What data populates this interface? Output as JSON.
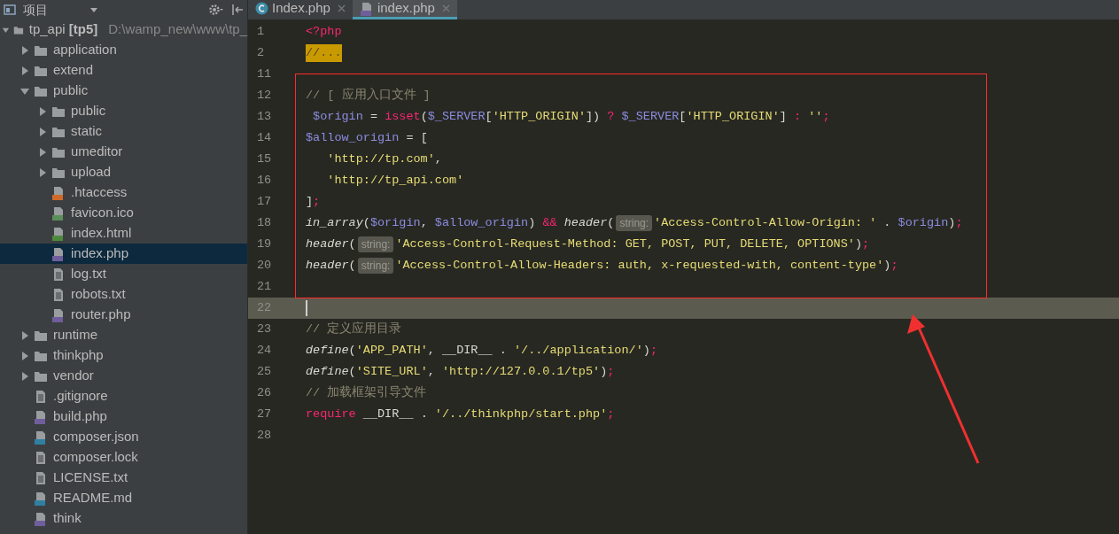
{
  "sidebar": {
    "title": "项目",
    "tree": [
      {
        "label": "tp_api **[tp5]**",
        "path": "D:\\wamp_new\\www\\tp_",
        "kind": "folder",
        "expanded": true,
        "selected": false,
        "children": [
          {
            "label": "application",
            "kind": "folder",
            "expanded": false,
            "selected": false
          },
          {
            "label": "extend",
            "kind": "folder",
            "expanded": false,
            "selected": false
          },
          {
            "label": "public",
            "kind": "folder",
            "expanded": true,
            "selected": false,
            "children": [
              {
                "label": "public",
                "kind": "folder",
                "expanded": false,
                "selected": false
              },
              {
                "label": "static",
                "kind": "folder",
                "expanded": false,
                "selected": false
              },
              {
                "label": "umeditor",
                "kind": "folder",
                "expanded": false,
                "selected": false
              },
              {
                "label": "upload",
                "kind": "folder",
                "expanded": false,
                "selected": false
              },
              {
                "label": ".htaccess",
                "kind": "config",
                "selected": false
              },
              {
                "label": "favicon.ico",
                "kind": "image",
                "selected": false
              },
              {
                "label": "index.html",
                "kind": "html",
                "selected": false
              },
              {
                "label": "index.php",
                "kind": "php",
                "selected": true
              },
              {
                "label": "log.txt",
                "kind": "text",
                "selected": false
              },
              {
                "label": "robots.txt",
                "kind": "text",
                "selected": false
              },
              {
                "label": "router.php",
                "kind": "php",
                "selected": false
              }
            ]
          },
          {
            "label": "runtime",
            "kind": "folder",
            "expanded": false,
            "selected": false
          },
          {
            "label": "thinkphp",
            "kind": "folder",
            "expanded": false,
            "selected": false
          },
          {
            "label": "vendor",
            "kind": "folder",
            "expanded": false,
            "selected": false
          },
          {
            "label": ".gitignore",
            "kind": "text",
            "selected": false
          },
          {
            "label": "build.php",
            "kind": "php",
            "selected": false
          },
          {
            "label": "composer.json",
            "kind": "json",
            "selected": false
          },
          {
            "label": "composer.lock",
            "kind": "text",
            "selected": false
          },
          {
            "label": "LICENSE.txt",
            "kind": "text",
            "selected": false
          },
          {
            "label": "README.md",
            "kind": "md",
            "selected": false
          },
          {
            "label": "think",
            "kind": "php",
            "selected": false
          }
        ]
      }
    ]
  },
  "tabs": [
    {
      "label": "Index.php",
      "kind": "class",
      "selected": false
    },
    {
      "label": "index.php",
      "kind": "php",
      "selected": true
    }
  ],
  "code": [
    {
      "number": "1",
      "current": false,
      "tokens": [
        {
          "kind": "keyword",
          "text": "<?php"
        }
      ]
    },
    {
      "number": "2",
      "current": false,
      "tokens": [
        {
          "kind": "fold",
          "text": "//..."
        }
      ]
    },
    {
      "number": "11",
      "current": false
    },
    {
      "number": "12",
      "current": false,
      "tokens": [
        {
          "kind": "comment",
          "text": "// [ 应用入口文件 ]"
        }
      ]
    },
    {
      "number": "13",
      "current": false,
      "tokens": [
        {
          "kind": "var",
          "text": " $origin"
        },
        {
          "kind": "plain",
          "text": " = "
        },
        {
          "kind": "keyword",
          "text": "isset"
        },
        {
          "kind": "plain",
          "text": "("
        },
        {
          "kind": "var",
          "text": "$_SERVER"
        },
        {
          "kind": "plain",
          "text": "["
        },
        {
          "kind": "string",
          "text": "'HTTP_ORIGIN'"
        },
        {
          "kind": "plain",
          "text": "]) "
        },
        {
          "kind": "keyword",
          "text": "?"
        },
        {
          "kind": "var",
          "text": " $_SERVER"
        },
        {
          "kind": "plain",
          "text": "["
        },
        {
          "kind": "string",
          "text": "'HTTP_ORIGIN'"
        },
        {
          "kind": "plain",
          "text": "] "
        },
        {
          "kind": "keyword",
          "text": ":"
        },
        {
          "kind": "string",
          "text": " ''"
        },
        {
          "kind": "keyword",
          "text": ";"
        }
      ]
    },
    {
      "number": "14",
      "current": false,
      "tokens": [
        {
          "kind": "var",
          "text": "$allow_origin"
        },
        {
          "kind": "plain",
          "text": " = ["
        }
      ]
    },
    {
      "number": "15",
      "current": false,
      "tokens": [
        {
          "kind": "string",
          "text": "   'http://tp.com'"
        },
        {
          "kind": "plain",
          "text": ","
        }
      ]
    },
    {
      "number": "16",
      "current": false,
      "tokens": [
        {
          "kind": "string",
          "text": "   'http://tp_api.com'"
        }
      ]
    },
    {
      "number": "17",
      "current": false,
      "tokens": [
        {
          "kind": "plain",
          "text": "]"
        },
        {
          "kind": "keyword",
          "text": ";"
        }
      ]
    },
    {
      "number": "18",
      "current": false,
      "tokens": [
        {
          "kind": "func",
          "text": "in_array"
        },
        {
          "kind": "plain",
          "text": "("
        },
        {
          "kind": "var",
          "text": "$origin"
        },
        {
          "kind": "plain",
          "text": ", "
        },
        {
          "kind": "var",
          "text": "$allow_origin"
        },
        {
          "kind": "plain",
          "text": ") "
        },
        {
          "kind": "keyword",
          "text": "&&"
        },
        {
          "kind": "func",
          "text": " header"
        },
        {
          "kind": "plain",
          "text": "("
        },
        {
          "kind": "hint",
          "text": "string:"
        },
        {
          "kind": "string",
          "text": "'Access-Control-Allow-Origin: '"
        },
        {
          "kind": "plain",
          "text": " . "
        },
        {
          "kind": "var",
          "text": "$origin"
        },
        {
          "kind": "plain",
          "text": ")"
        },
        {
          "kind": "keyword",
          "text": ";"
        }
      ]
    },
    {
      "number": "19",
      "current": false,
      "tokens": [
        {
          "kind": "func",
          "text": "header"
        },
        {
          "kind": "plain",
          "text": "("
        },
        {
          "kind": "hint",
          "text": "string:"
        },
        {
          "kind": "string",
          "text": "'Access-Control-Request-Method: GET, POST, PUT, DELETE, OPTIONS'"
        },
        {
          "kind": "plain",
          "text": ")"
        },
        {
          "kind": "keyword",
          "text": ";"
        }
      ]
    },
    {
      "number": "20",
      "current": false,
      "tokens": [
        {
          "kind": "func",
          "text": "header"
        },
        {
          "kind": "plain",
          "text": "("
        },
        {
          "kind": "hint",
          "text": "string:"
        },
        {
          "kind": "string",
          "text": "'Access-Control-Allow-Headers: auth, x-requested-with, content-type'"
        },
        {
          "kind": "plain",
          "text": ")"
        },
        {
          "kind": "keyword",
          "text": ";"
        }
      ]
    },
    {
      "number": "21",
      "current": false
    },
    {
      "number": "22",
      "current": true
    },
    {
      "number": "23",
      "current": false,
      "tokens": [
        {
          "kind": "comment",
          "text": "// 定义应用目录"
        }
      ]
    },
    {
      "number": "24",
      "current": false,
      "tokens": [
        {
          "kind": "func",
          "text": "define"
        },
        {
          "kind": "plain",
          "text": "("
        },
        {
          "kind": "string",
          "text": "'APP_PATH'"
        },
        {
          "kind": "plain",
          "text": ", __DIR__ . "
        },
        {
          "kind": "string",
          "text": "'/../application/'"
        },
        {
          "kind": "plain",
          "text": ")"
        },
        {
          "kind": "keyword",
          "text": ";"
        }
      ]
    },
    {
      "number": "25",
      "current": false,
      "tokens": [
        {
          "kind": "func",
          "text": "define"
        },
        {
          "kind": "plain",
          "text": "("
        },
        {
          "kind": "string",
          "text": "'SITE_URL'"
        },
        {
          "kind": "plain",
          "text": ", "
        },
        {
          "kind": "string",
          "text": "'http://127.0.0.1/tp5'"
        },
        {
          "kind": "plain",
          "text": ")"
        },
        {
          "kind": "keyword",
          "text": ";"
        }
      ]
    },
    {
      "number": "26",
      "current": false,
      "tokens": [
        {
          "kind": "comment",
          "text": "// 加载框架引导文件"
        }
      ]
    },
    {
      "number": "27",
      "current": false,
      "tokens": [
        {
          "kind": "keyword",
          "text": "require"
        },
        {
          "kind": "plain",
          "text": " __DIR__ . "
        },
        {
          "kind": "string",
          "text": "'/../thinkphp/start.php'"
        },
        {
          "kind": "keyword",
          "text": ";"
        }
      ]
    },
    {
      "number": "28",
      "current": false
    }
  ],
  "annotation": {
    "kind": "box-and-arrow"
  }
}
